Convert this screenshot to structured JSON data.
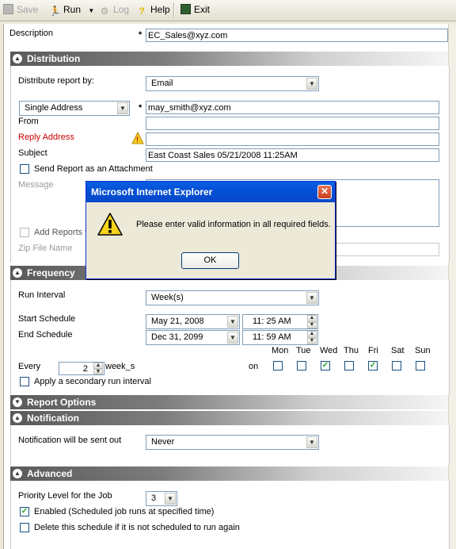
{
  "toolbar": {
    "save": "Save",
    "run": "Run",
    "log": "Log",
    "help": "Help",
    "exit": "Exit"
  },
  "description": {
    "label": "Description",
    "value": "EC_Sales@xyz.com"
  },
  "distribution": {
    "header": "Distribution",
    "distribute_by_label": "Distribute report by:",
    "distribute_by_value": "Email",
    "address_type": "Single Address",
    "to_value": "may_smith@xyz.com",
    "from_label": "From",
    "reply_label": "Reply Address",
    "subject_label": "Subject",
    "subject_value": "East Coast Sales 05/21/2008 11:25AM",
    "attach_label": "Send Report as an Attachment",
    "message_label": "Message",
    "add_reports_label": "Add Reports t",
    "zip_label": "Zip File Name"
  },
  "frequency": {
    "header": "Frequency",
    "run_interval_label": "Run Interval",
    "run_interval_value": "Week(s)",
    "start_label": "Start Schedule",
    "start_date": "May 21, 2008",
    "start_time": "11: 25  AM",
    "end_label": "End Schedule",
    "end_date": "Dec 31, 2099",
    "end_time": "11: 59  AM",
    "every_label": "Every",
    "every_value": "2",
    "every_unit": "week_s",
    "on_label": "on",
    "days": [
      "Mon",
      "Tue",
      "Wed",
      "Thu",
      "Fri",
      "Sat",
      "Sun"
    ],
    "days_checked": [
      false,
      false,
      true,
      false,
      true,
      false,
      false
    ],
    "secondary_label": "Apply a secondary run interval"
  },
  "report_options": {
    "header": "Report Options"
  },
  "notification": {
    "header": "Notification",
    "label": "Notification will be sent out",
    "value": "Never"
  },
  "advanced": {
    "header": "Advanced",
    "priority_label": "Priority Level for the Job",
    "priority_value": "3",
    "enabled_label": "Enabled (Scheduled job runs at specified time)",
    "delete_label": "Delete this schedule if it is not scheduled to run again"
  },
  "dialog": {
    "title": "Microsoft Internet Explorer",
    "message": "Please enter valid information in all required fields.",
    "ok": "OK"
  },
  "colors": {
    "required_label": "#cc0000",
    "dialog_title": "#0451d6",
    "check_mark": "#21a121"
  }
}
